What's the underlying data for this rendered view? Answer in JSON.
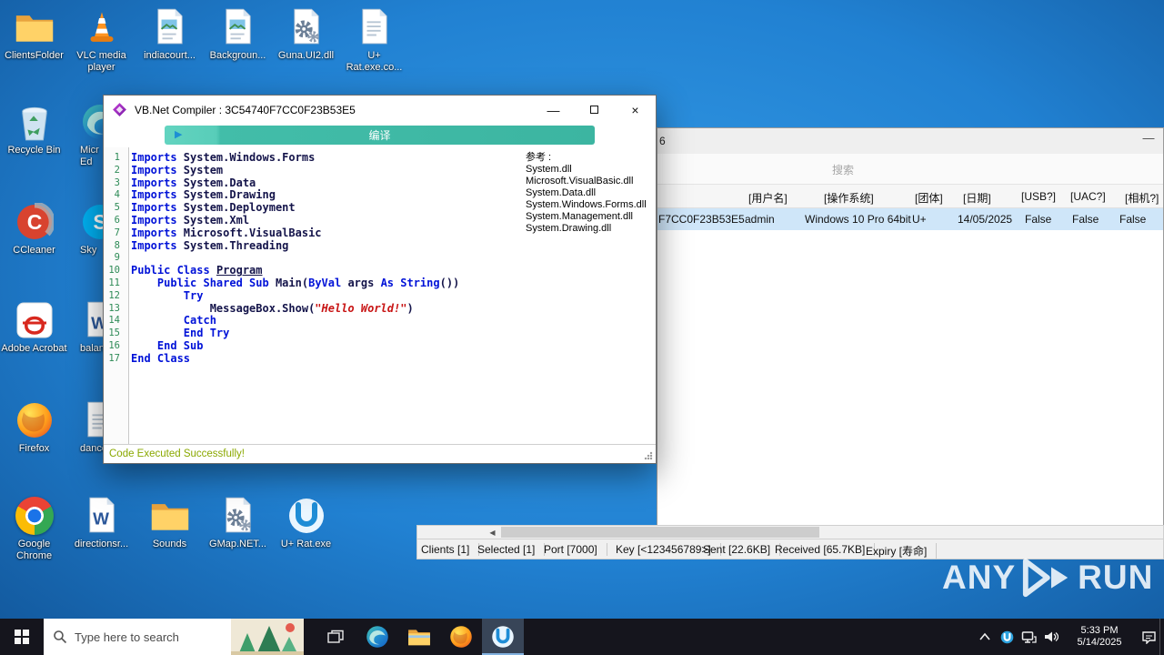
{
  "desktop": {
    "top_icons": [
      {
        "label": "ClientsFolder",
        "icon": "folder"
      },
      {
        "label": "VLC media player",
        "icon": "vlc"
      },
      {
        "label": "indiacourt...",
        "icon": "doc-image"
      },
      {
        "label": "Backgroun...",
        "icon": "doc-image"
      },
      {
        "label": "Guna.UI2.dll",
        "icon": "gear"
      },
      {
        "label": "U+ Rat.exe.co...",
        "icon": "doc"
      }
    ],
    "left_icons": [
      {
        "label": "Recycle Bin",
        "icon": "recycle-bin"
      },
      {
        "label": "CCleaner",
        "icon": "ccleaner"
      },
      {
        "label": "Adobe Acrobat",
        "icon": "acrobat"
      },
      {
        "label": "Firefox",
        "icon": "firefox"
      }
    ],
    "partial_icons": [
      {
        "label": "Micr\nEd",
        "icon": "edge"
      },
      {
        "label": "Sky",
        "icon": "skype"
      },
      {
        "label": "balanc",
        "icon": "word"
      },
      {
        "label": "dance",
        "icon": "doc"
      }
    ],
    "bottom_icons": [
      {
        "label": "Google Chrome",
        "icon": "chrome"
      },
      {
        "label": "directionsr...",
        "icon": "word"
      },
      {
        "label": "Sounds",
        "icon": "folder"
      },
      {
        "label": "GMap.NET...",
        "icon": "gear"
      },
      {
        "label": "U+ Rat.exe",
        "icon": "urat"
      }
    ]
  },
  "compiler_window": {
    "title": "VB.Net Compiler : 3C54740F7CC0F23B53E5",
    "compile_button_label": "编译",
    "status_message": "Code Executed Successfully!",
    "references_header": "参考 :",
    "references": [
      "System.dll",
      "Microsoft.VisualBasic.dll",
      "System.Data.dll",
      "System.Windows.Forms.dll",
      "System.Management.dll",
      "System.Drawing.dll"
    ],
    "code_lines": [
      {
        "n": "1",
        "segs": [
          [
            "k",
            "Imports"
          ],
          [
            "p",
            " System.Windows.Forms"
          ]
        ]
      },
      {
        "n": "2",
        "segs": [
          [
            "k",
            "Imports"
          ],
          [
            "p",
            " System"
          ]
        ]
      },
      {
        "n": "3",
        "segs": [
          [
            "k",
            "Imports"
          ],
          [
            "p",
            " System.Data"
          ]
        ]
      },
      {
        "n": "4",
        "segs": [
          [
            "k",
            "Imports"
          ],
          [
            "p",
            " System.Drawing"
          ]
        ]
      },
      {
        "n": "5",
        "segs": [
          [
            "k",
            "Imports"
          ],
          [
            "p",
            " System.Deployment"
          ]
        ]
      },
      {
        "n": "6",
        "segs": [
          [
            "k",
            "Imports"
          ],
          [
            "p",
            " System.Xml"
          ]
        ]
      },
      {
        "n": "7",
        "segs": [
          [
            "k",
            "Imports"
          ],
          [
            "p",
            " Microsoft.VisualBasic"
          ]
        ]
      },
      {
        "n": "8",
        "segs": [
          [
            "k",
            "Imports"
          ],
          [
            "p",
            " System.Threading"
          ]
        ]
      },
      {
        "n": "9",
        "segs": []
      },
      {
        "n": "10",
        "segs": [
          [
            "k",
            "Public Class"
          ],
          [
            "p",
            " "
          ],
          [
            "u",
            "Program"
          ]
        ]
      },
      {
        "n": "11",
        "segs": [
          [
            "p",
            "    "
          ],
          [
            "k",
            "Public Shared Sub"
          ],
          [
            "p",
            " Main("
          ],
          [
            "k",
            "ByVal"
          ],
          [
            "p",
            " args "
          ],
          [
            "k",
            "As String"
          ],
          [
            "p",
            "())"
          ]
        ]
      },
      {
        "n": "12",
        "segs": [
          [
            "p",
            "        "
          ],
          [
            "k",
            "Try"
          ]
        ]
      },
      {
        "n": "13",
        "segs": [
          [
            "p",
            "            MessageBox.Show("
          ],
          [
            "s",
            "\"Hello World!\""
          ],
          [
            "p",
            ")"
          ]
        ]
      },
      {
        "n": "14",
        "segs": [
          [
            "p",
            "        "
          ],
          [
            "k",
            "Catch"
          ]
        ]
      },
      {
        "n": "15",
        "segs": [
          [
            "p",
            "        "
          ],
          [
            "k",
            "End Try"
          ]
        ]
      },
      {
        "n": "16",
        "segs": [
          [
            "p",
            "    "
          ],
          [
            "k",
            "End Sub"
          ]
        ]
      },
      {
        "n": "17",
        "segs": [
          [
            "k",
            "End Class"
          ]
        ]
      }
    ]
  },
  "rat_window": {
    "title_fragment": "6",
    "search_placeholder": "搜索",
    "columns": [
      "[用户名]",
      "[操作系统]",
      "[团体]",
      "[日期]",
      "[USB?]",
      "[UAC?]",
      "[相机?]"
    ],
    "client_row": [
      "F7CC0F23B53E5",
      "admin",
      "Windows 10 Pro 64bit",
      "U+",
      "14/05/2025",
      "False",
      "False",
      "False"
    ],
    "status_items": [
      "Clients [1]",
      "Selected [1]",
      "Port [7000]",
      "Key [<123456789>]",
      "Sent [22.6KB]",
      "Received [65.7KB]",
      "Expiry [寿命]"
    ]
  },
  "watermark": {
    "left": "ANY",
    "right": "RUN"
  },
  "taskbar": {
    "start_icon": "windows-start",
    "search_placeholder": "Type here to search",
    "app_icons": [
      "task-view",
      "edge",
      "file-explorer",
      "firefox",
      "u-rat"
    ],
    "active_app": "u-rat",
    "tray_icons": [
      "hidden-icons-chevron",
      "u-rat-tray",
      "network",
      "volume"
    ],
    "time": "5:33 PM",
    "date": "5/14/2025"
  }
}
